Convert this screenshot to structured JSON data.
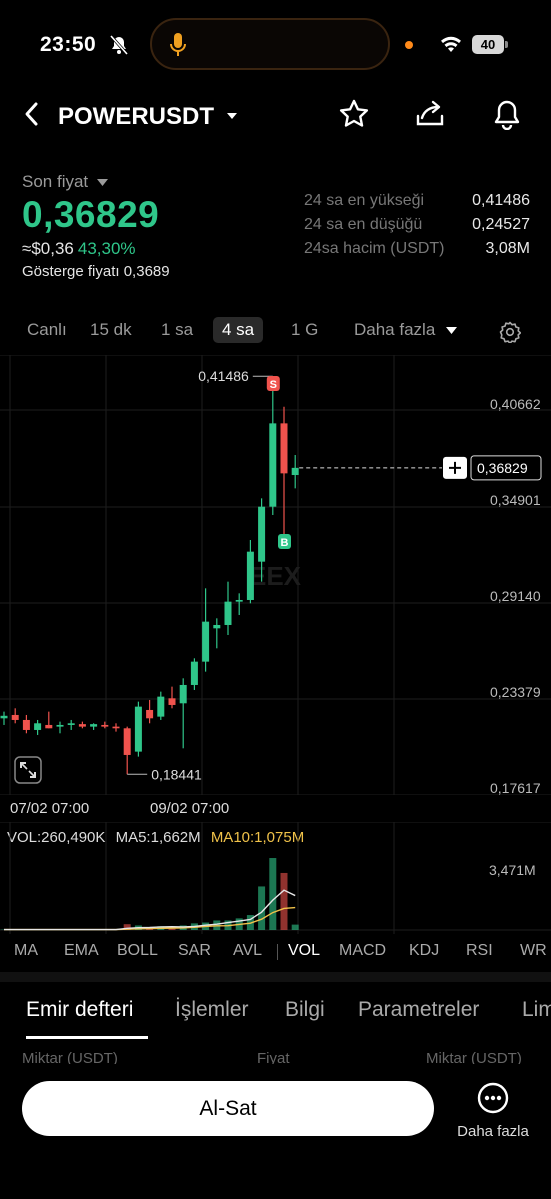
{
  "status": {
    "time": "23:50",
    "battery": "40"
  },
  "header": {
    "symbol": "POWERUSDT"
  },
  "price": {
    "last_label": "Son fiyat",
    "last": "0,36829",
    "usd": "≈$0,36",
    "change_pct": "43,30%",
    "index_label": "Gösterge fiyatı",
    "index_value": "0,3689"
  },
  "stats": [
    {
      "label": "24 sa en yükseği",
      "value": "0,41486"
    },
    {
      "label": "24 sa en düşüğü",
      "value": "0,24527"
    },
    {
      "label": "24sa hacim (USDT)",
      "value": "3,08M"
    }
  ],
  "intervals": {
    "live": "Canlı",
    "m15": "15 dk",
    "h1": "1 sa",
    "h4": "4 sa",
    "d1": "1 G",
    "more": "Daha fazla"
  },
  "chart_data": {
    "type": "candlestick",
    "y_ticks": [
      "0,40662",
      "0,34901",
      "0,29140",
      "0,23379",
      "0,17617"
    ],
    "y_tick_values": [
      0.40662,
      0.34901,
      0.2914,
      0.23379,
      0.17617
    ],
    "x_ticks": [
      "07/02 07:00",
      "09/02 07:00"
    ],
    "last_price_tag": "0,36829",
    "high_label": "0,41486",
    "low_label": "0,18441",
    "sell_marker": "S",
    "buy_marker": "B",
    "watermark": "EEX",
    "candles": [
      {
        "o": 0.218,
        "h": 0.222,
        "l": 0.214,
        "c": 0.2195,
        "up": true
      },
      {
        "o": 0.22,
        "h": 0.224,
        "l": 0.215,
        "c": 0.217,
        "up": false
      },
      {
        "o": 0.217,
        "h": 0.22,
        "l": 0.209,
        "c": 0.211,
        "up": false
      },
      {
        "o": 0.211,
        "h": 0.217,
        "l": 0.208,
        "c": 0.215,
        "up": true
      },
      {
        "o": 0.214,
        "h": 0.222,
        "l": 0.212,
        "c": 0.212,
        "up": false
      },
      {
        "o": 0.213,
        "h": 0.216,
        "l": 0.209,
        "c": 0.214,
        "up": true
      },
      {
        "o": 0.214,
        "h": 0.217,
        "l": 0.211,
        "c": 0.215,
        "up": true
      },
      {
        "o": 0.2145,
        "h": 0.216,
        "l": 0.212,
        "c": 0.213,
        "up": false
      },
      {
        "o": 0.213,
        "h": 0.215,
        "l": 0.211,
        "c": 0.2145,
        "up": true
      },
      {
        "o": 0.214,
        "h": 0.216,
        "l": 0.212,
        "c": 0.213,
        "up": false
      },
      {
        "o": 0.213,
        "h": 0.215,
        "l": 0.21,
        "c": 0.212,
        "up": false
      },
      {
        "o": 0.212,
        "h": 0.213,
        "l": 0.1844,
        "c": 0.196,
        "up": false
      },
      {
        "o": 0.198,
        "h": 0.228,
        "l": 0.195,
        "c": 0.225,
        "up": true
      },
      {
        "o": 0.223,
        "h": 0.229,
        "l": 0.215,
        "c": 0.218,
        "up": false
      },
      {
        "o": 0.219,
        "h": 0.234,
        "l": 0.217,
        "c": 0.231,
        "up": true
      },
      {
        "o": 0.23,
        "h": 0.237,
        "l": 0.224,
        "c": 0.226,
        "up": false
      },
      {
        "o": 0.227,
        "h": 0.242,
        "l": 0.2,
        "c": 0.238,
        "up": true
      },
      {
        "o": 0.238,
        "h": 0.254,
        "l": 0.235,
        "c": 0.252,
        "up": true
      },
      {
        "o": 0.252,
        "h": 0.296,
        "l": 0.246,
        "c": 0.276,
        "up": true
      },
      {
        "o": 0.272,
        "h": 0.278,
        "l": 0.26,
        "c": 0.274,
        "up": true
      },
      {
        "o": 0.274,
        "h": 0.3,
        "l": 0.268,
        "c": 0.288,
        "up": true
      },
      {
        "o": 0.288,
        "h": 0.293,
        "l": 0.28,
        "c": 0.289,
        "up": true
      },
      {
        "o": 0.289,
        "h": 0.325,
        "l": 0.287,
        "c": 0.318,
        "up": true
      },
      {
        "o": 0.312,
        "h": 0.35,
        "l": 0.3,
        "c": 0.345,
        "up": true
      },
      {
        "o": 0.345,
        "h": 0.4149,
        "l": 0.34,
        "c": 0.395,
        "up": true
      },
      {
        "o": 0.395,
        "h": 0.405,
        "l": 0.32,
        "c": 0.365,
        "up": false
      },
      {
        "o": 0.364,
        "h": 0.376,
        "l": 0.356,
        "c": 0.3683,
        "up": true
      }
    ],
    "volume": {
      "label": "VOL:260,490K",
      "ma5": "MA5:1,662M",
      "ma10": "MA10:1,075M",
      "max_tick": "3,471M",
      "max_value": 3.471,
      "values": [
        0.02,
        0.02,
        0.03,
        0.02,
        0.02,
        0.02,
        0.02,
        0.02,
        0.02,
        0.02,
        0.02,
        0.28,
        0.22,
        0.05,
        0.18,
        0.06,
        0.22,
        0.32,
        0.36,
        0.46,
        0.46,
        0.56,
        0.72,
        2.1,
        3.47,
        2.75,
        0.26
      ],
      "ma5_values": [
        0.02,
        0.02,
        0.02,
        0.02,
        0.02,
        0.02,
        0.02,
        0.02,
        0.02,
        0.02,
        0.02,
        0.08,
        0.11,
        0.12,
        0.15,
        0.16,
        0.15,
        0.17,
        0.23,
        0.28,
        0.36,
        0.43,
        0.51,
        0.86,
        1.44,
        1.92,
        1.66
      ],
      "ma10_values": [
        0.02,
        0.02,
        0.02,
        0.02,
        0.02,
        0.02,
        0.02,
        0.02,
        0.02,
        0.02,
        0.02,
        0.04,
        0.06,
        0.07,
        0.08,
        0.09,
        0.1,
        0.13,
        0.17,
        0.2,
        0.21,
        0.27,
        0.33,
        0.52,
        0.84,
        1.04,
        1.08
      ]
    }
  },
  "indicators": [
    "MA",
    "EMA",
    "BOLL",
    "SAR",
    "AVL",
    "VOL",
    "MACD",
    "KDJ",
    "RSI",
    "WR"
  ],
  "tabs": [
    "Emir defteri",
    "İşlemler",
    "Bilgi",
    "Parametreler",
    "Lim"
  ],
  "book_header": {
    "left": "Miktar (USDT)",
    "mid": "Fiyat",
    "right": "Miktar (USDT)"
  },
  "bottom": {
    "trade": "Al-Sat",
    "more": "Daha fazla"
  },
  "colors": {
    "up": "#2fc68a",
    "down": "#f0534d",
    "ma10": "#f0c24a",
    "ma5": "#e6e6e6"
  }
}
